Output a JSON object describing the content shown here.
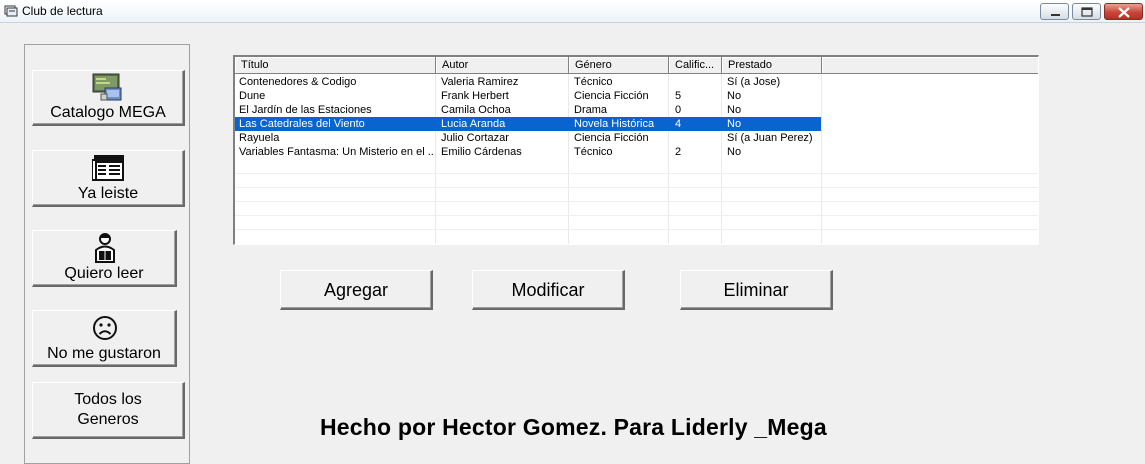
{
  "window": {
    "title": "Club de lectura"
  },
  "nav": {
    "catalogo": "Catalogo MEGA",
    "ya_leiste": "Ya  leiste",
    "quiero_leer": "Quiero leer",
    "no_me_gustaron": "No me gustaron",
    "todos_line1": "Todos los",
    "todos_line2": "Generos"
  },
  "table": {
    "columns": [
      "Título",
      "Autor",
      "Género",
      "Calific...",
      "Prestado"
    ],
    "rows": [
      [
        "Contenedores & Codigo",
        "Valeria Ramirez",
        "Técnico",
        "",
        "Sí (a Jose)"
      ],
      [
        "Dune",
        "Frank Herbert",
        "Ciencia Ficción",
        "5",
        "No"
      ],
      [
        "El Jardín de las Estaciones",
        "Camila Ochoa",
        "Drama",
        "0",
        "No"
      ],
      [
        "Las Catedrales del Viento",
        "Lucia Aranda",
        "Novela Histórica",
        "4",
        "No"
      ],
      [
        "Rayuela",
        "Julio Cortazar",
        "Ciencia Ficción",
        "",
        "Sí (a Juan Perez)"
      ],
      [
        "Variables Fantasma: Un Misterio en el ...",
        "Emilio Cárdenas",
        "Técnico",
        "2",
        "No"
      ]
    ],
    "selected_row": 3
  },
  "actions": {
    "agregar": "Agregar",
    "modificar": "Modificar",
    "eliminar": "Eliminar"
  },
  "footer": "Hecho por Hector Gomez. Para Liderly _Mega",
  "icons": {
    "app": "app-icon",
    "catalogo": "monitor-icon",
    "ya_leiste": "newspaper-icon",
    "quiero_leer": "reader-person-icon",
    "no_me_gustaron": "sad-face-icon"
  },
  "colors": {
    "selection": "#0a64d0",
    "background": "#f0f0f0"
  }
}
